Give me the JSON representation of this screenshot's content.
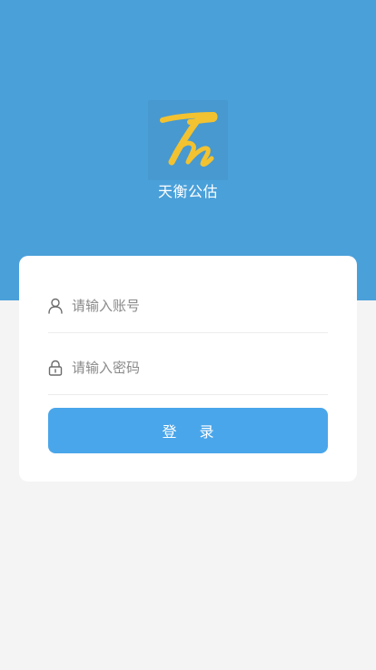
{
  "app": {
    "name": "天衡公估",
    "logo_icon": "app-logo-h-icon"
  },
  "login": {
    "account_placeholder": "请输入账号",
    "account_value": "",
    "account_icon": "user-icon",
    "password_placeholder": "请输入密码",
    "password_value": "",
    "password_icon": "lock-icon",
    "submit_label": "登 录"
  },
  "colors": {
    "header_bg": "#4aa0d9",
    "page_bg": "#f4f4f4",
    "button_bg": "#4aa6ea",
    "logo_yellow": "#f2c230"
  }
}
